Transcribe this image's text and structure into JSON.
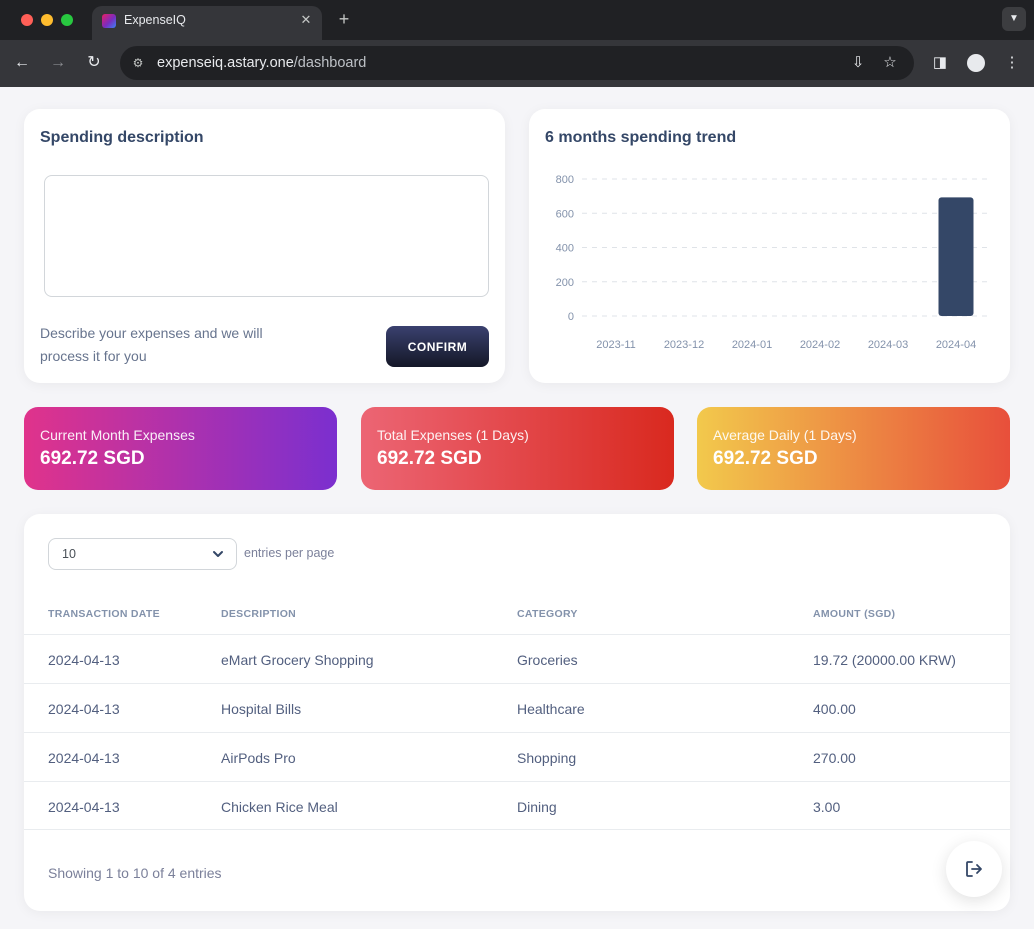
{
  "browser": {
    "tab_title": "ExpenseIQ",
    "url_host": "expenseiq.astary.one",
    "url_path": "/dashboard"
  },
  "description_card": {
    "title": "Spending description",
    "textarea_value": "",
    "help_text": "Describe your expenses and we will process it for you",
    "confirm_label": "CONFIRM"
  },
  "trend_card": {
    "title": "6 months spending trend"
  },
  "chart_data": {
    "type": "bar",
    "categories": [
      "2023-11",
      "2023-12",
      "2024-01",
      "2024-02",
      "2024-03",
      "2024-04"
    ],
    "values": [
      0,
      0,
      0,
      0,
      0,
      692.72
    ],
    "ylim": [
      0,
      800
    ],
    "yticks": [
      0,
      200,
      400,
      600,
      800
    ],
    "grid": true,
    "bar_color": "#344767"
  },
  "stats": [
    {
      "label": "Current Month Expenses",
      "value": "692.72 SGD"
    },
    {
      "label": "Total Expenses (1 Days)",
      "value": "692.72 SGD"
    },
    {
      "label": "Average Daily (1 Days)",
      "value": "692.72 SGD"
    }
  ],
  "table": {
    "entries_per_page": "10",
    "entries_label": "entries per page",
    "headers": [
      "TRANSACTION DATE",
      "DESCRIPTION",
      "CATEGORY",
      "AMOUNT (SGD)"
    ],
    "rows": [
      {
        "date": "2024-04-13",
        "description": "eMart Grocery Shopping",
        "category": "Groceries",
        "amount": "19.72 (20000.00 KRW)"
      },
      {
        "date": "2024-04-13",
        "description": "Hospital Bills",
        "category": "Healthcare",
        "amount": "400.00"
      },
      {
        "date": "2024-04-13",
        "description": "AirPods Pro",
        "category": "Shopping",
        "amount": "270.00"
      },
      {
        "date": "2024-04-13",
        "description": "Chicken Rice Meal",
        "category": "Dining",
        "amount": "3.00"
      }
    ],
    "showing_text": "Showing 1 to 10 of 4 entries"
  },
  "icons": {
    "fab": "logout-icon"
  }
}
